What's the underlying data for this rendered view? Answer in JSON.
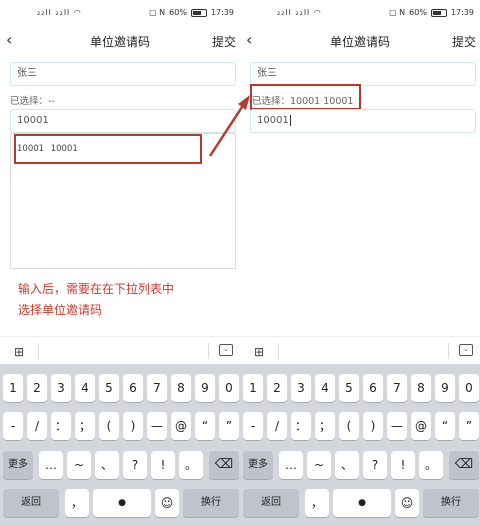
{
  "status_bar": {
    "signal": "₂₂ll ₂₂ll ◠",
    "battery_pct": "60%",
    "time": "17:39",
    "extra": "▢ N"
  },
  "nav": {
    "back": "‹",
    "title": "单位邀请码",
    "submit": "提交"
  },
  "left": {
    "name_value": "张三",
    "selected_label": "已选择：--",
    "code_value": "10001",
    "dropdown_item": "10001 10001",
    "hint_line1": "输入后，需要在在下拉列表中",
    "hint_line2": "选择单位邀请码"
  },
  "right": {
    "name_value": "张三",
    "selected_label": "已选择：10001 10001",
    "code_value": "10001"
  },
  "keyboard": {
    "grid_icon": "⊞",
    "collapse_icon": "⌵",
    "row1": [
      "1",
      "2",
      "3",
      "4",
      "5",
      "6",
      "7",
      "8",
      "9",
      "0"
    ],
    "row2": [
      "-",
      "/",
      "：",
      "；",
      "(",
      ")",
      "—",
      "@",
      "“",
      "”"
    ],
    "row3": [
      "更多",
      "…",
      "~",
      "、",
      "?",
      "!",
      "。",
      "⌫"
    ],
    "row4": [
      "返回",
      "，",
      "🎙",
      "☺",
      "换行"
    ]
  },
  "colors": {
    "accent_red": "#b33a2f",
    "hint_red": "#c83b2e",
    "field_border": "#cfe7ee",
    "keyboard_bg": "#d3d6dc"
  }
}
